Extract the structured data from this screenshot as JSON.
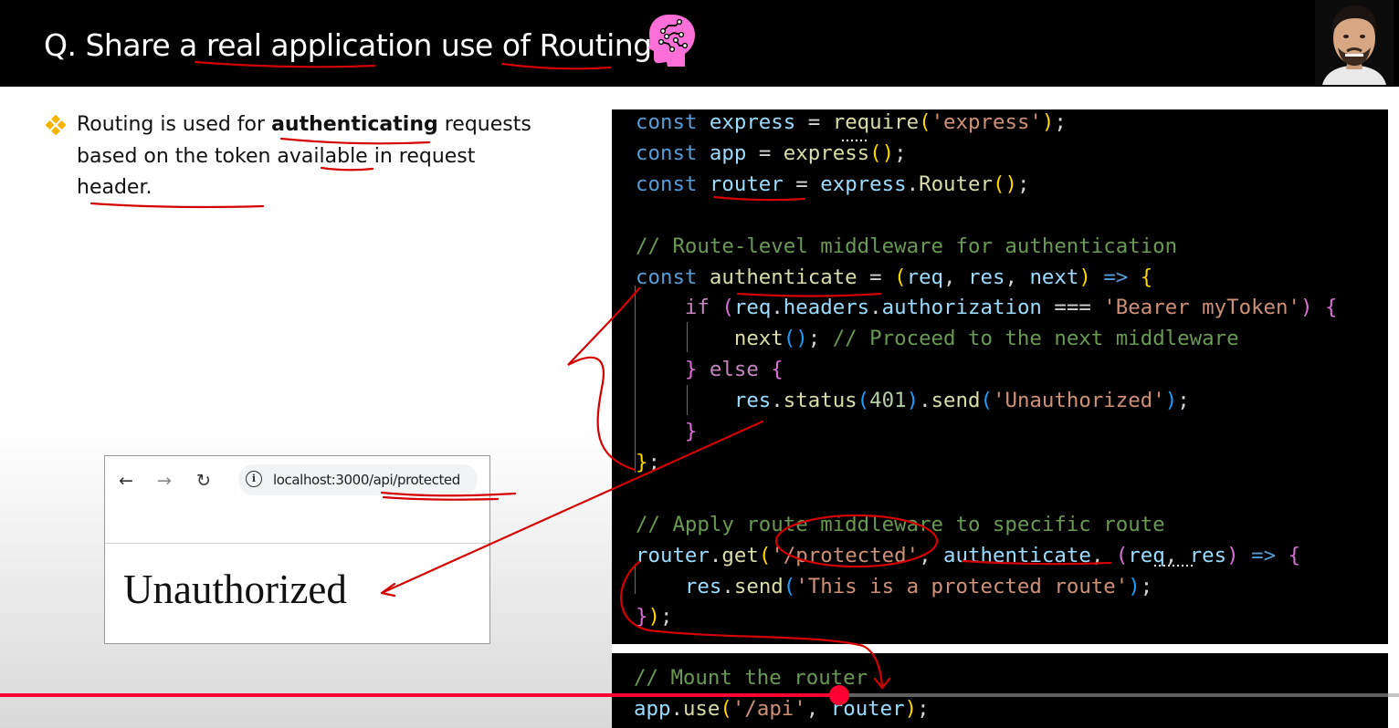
{
  "header": {
    "title": "Q. Share a real application use of Routing?",
    "brain_icon": "brain-circuit-icon",
    "presenter_avatar": "presenter-avatar",
    "accent_color": "#ff6fd8"
  },
  "bullet": {
    "icon": "diamond-bullet-icon",
    "text_before": "Routing is used for ",
    "text_bold": "authenticating",
    "text_after": " requests based on the token available in request header."
  },
  "browser": {
    "back_icon": "←",
    "forward_icon": "→",
    "reload_icon": "↻",
    "info_icon": "i",
    "url": "localhost:3000/api/protected",
    "page_text": "Unauthorized"
  },
  "code_main": [
    [
      [
        "kw",
        "const"
      ],
      [
        "pl",
        " "
      ],
      [
        "var",
        "express"
      ],
      [
        "pl",
        " = "
      ],
      [
        "fn",
        "require"
      ],
      [
        "p1",
        "("
      ],
      [
        "str",
        "'express'"
      ],
      [
        "p1",
        ")"
      ],
      [
        "pl",
        ";"
      ]
    ],
    [
      [
        "kw",
        "const"
      ],
      [
        "pl",
        " "
      ],
      [
        "var",
        "app"
      ],
      [
        "pl",
        " = "
      ],
      [
        "fn",
        "express"
      ],
      [
        "p1",
        "()"
      ],
      [
        "pl",
        ";"
      ]
    ],
    [
      [
        "kw",
        "const"
      ],
      [
        "pl",
        " "
      ],
      [
        "var",
        "router"
      ],
      [
        "pl",
        " = "
      ],
      [
        "var",
        "express"
      ],
      [
        "pl",
        "."
      ],
      [
        "fn",
        "Router"
      ],
      [
        "p1",
        "()"
      ],
      [
        "pl",
        ";"
      ]
    ],
    [],
    [
      [
        "cm",
        "// Route-level middleware for authentication"
      ]
    ],
    [
      [
        "kw",
        "const"
      ],
      [
        "pl",
        " "
      ],
      [
        "fn",
        "authenticate"
      ],
      [
        "pl",
        " = "
      ],
      [
        "p1",
        "("
      ],
      [
        "var",
        "req"
      ],
      [
        "pl",
        ", "
      ],
      [
        "var",
        "res"
      ],
      [
        "pl",
        ", "
      ],
      [
        "var",
        "next"
      ],
      [
        "p1",
        ")"
      ],
      [
        "pl",
        " "
      ],
      [
        "kw",
        "=>"
      ],
      [
        "pl",
        " "
      ],
      [
        "p1",
        "{"
      ]
    ],
    [
      [
        "pl",
        "    "
      ],
      [
        "ctl",
        "if"
      ],
      [
        "pl",
        " "
      ],
      [
        "p2",
        "("
      ],
      [
        "var",
        "req"
      ],
      [
        "pl",
        "."
      ],
      [
        "var",
        "headers"
      ],
      [
        "pl",
        "."
      ],
      [
        "var",
        "authorization"
      ],
      [
        "pl",
        " === "
      ],
      [
        "str",
        "'Bearer myToken'"
      ],
      [
        "p2",
        ")"
      ],
      [
        "pl",
        " "
      ],
      [
        "p2",
        "{"
      ]
    ],
    [
      [
        "pl",
        "        "
      ],
      [
        "fn",
        "next"
      ],
      [
        "p3",
        "()"
      ],
      [
        "pl",
        "; "
      ],
      [
        "cm",
        "// Proceed to the next middleware"
      ]
    ],
    [
      [
        "pl",
        "    "
      ],
      [
        "p2",
        "}"
      ],
      [
        "pl",
        " "
      ],
      [
        "ctl",
        "else"
      ],
      [
        "pl",
        " "
      ],
      [
        "p2",
        "{"
      ]
    ],
    [
      [
        "pl",
        "        "
      ],
      [
        "var",
        "res"
      ],
      [
        "pl",
        "."
      ],
      [
        "fn",
        "status"
      ],
      [
        "p3",
        "("
      ],
      [
        "num",
        "401"
      ],
      [
        "p3",
        ")"
      ],
      [
        "pl",
        "."
      ],
      [
        "fn",
        "send"
      ],
      [
        "p3",
        "("
      ],
      [
        "str",
        "'Unauthorized'"
      ],
      [
        "p3",
        ")"
      ],
      [
        "pl",
        ";"
      ]
    ],
    [
      [
        "pl",
        "    "
      ],
      [
        "p2",
        "}"
      ]
    ],
    [
      [
        "p1",
        "}"
      ],
      [
        "pl",
        ";"
      ]
    ],
    [],
    [
      [
        "cm",
        "// Apply route middleware to specific route"
      ]
    ],
    [
      [
        "var",
        "router"
      ],
      [
        "pl",
        "."
      ],
      [
        "fn",
        "get"
      ],
      [
        "p1",
        "("
      ],
      [
        "str",
        "'/protected'"
      ],
      [
        "pl",
        ", "
      ],
      [
        "var",
        "authenticate"
      ],
      [
        "pl",
        ", "
      ],
      [
        "p2",
        "("
      ],
      [
        "var",
        "req"
      ],
      [
        "pl",
        ", "
      ],
      [
        "var",
        "res"
      ],
      [
        "p2",
        ")"
      ],
      [
        "pl",
        " "
      ],
      [
        "kw",
        "=>"
      ],
      [
        "pl",
        " "
      ],
      [
        "p2",
        "{"
      ]
    ],
    [
      [
        "pl",
        "    "
      ],
      [
        "var",
        "res"
      ],
      [
        "pl",
        "."
      ],
      [
        "fn",
        "send"
      ],
      [
        "p3",
        "("
      ],
      [
        "str",
        "'This is a protected route'"
      ],
      [
        "p3",
        ")"
      ],
      [
        "pl",
        ";"
      ]
    ],
    [
      [
        "p2",
        "}"
      ],
      [
        "p1",
        ")"
      ],
      [
        "pl",
        ";"
      ]
    ]
  ],
  "code_mount": [
    [
      [
        "cm",
        "// Mount the router"
      ]
    ],
    [
      [
        "var",
        "app"
      ],
      [
        "pl",
        "."
      ],
      [
        "fn",
        "use"
      ],
      [
        "p1",
        "("
      ],
      [
        "str",
        "'/api'"
      ],
      [
        "pl",
        ", "
      ],
      [
        "var",
        "router"
      ],
      [
        "p1",
        ")"
      ],
      [
        "pl",
        ";"
      ]
    ]
  ],
  "player": {
    "progress_fraction": 0.6,
    "progress_color": "#ff0033"
  },
  "annotations": {
    "color": "#d40000"
  }
}
